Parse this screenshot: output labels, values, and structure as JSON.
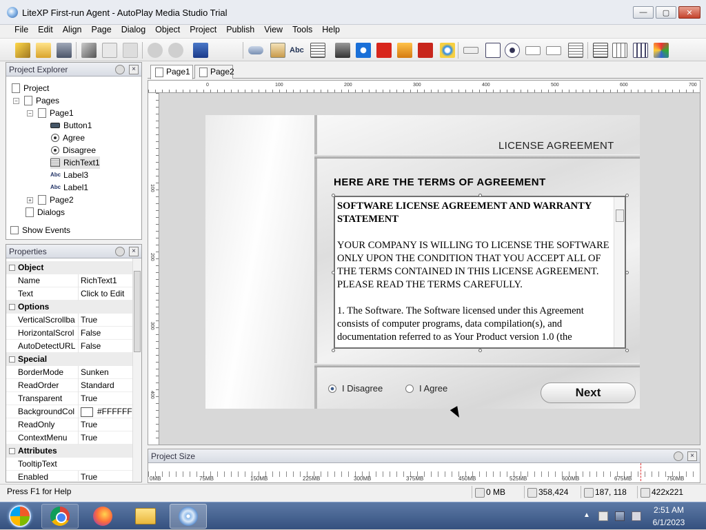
{
  "window": {
    "title": "LiteXP First-run Agent - AutoPlay Media Studio Trial",
    "min_glyph": "—",
    "max_glyph": "▢",
    "close_glyph": "✕"
  },
  "menu": [
    "File",
    "Edit",
    "Align",
    "Page",
    "Dialog",
    "Object",
    "Project",
    "Publish",
    "View",
    "Tools",
    "Help"
  ],
  "explorer": {
    "title": "Project Explorer",
    "tree": {
      "project": "Project",
      "pages": "Pages",
      "page1": "Page1",
      "button1": "Button1",
      "agree": "Agree",
      "disagree": "Disagree",
      "richtext1": "RichText1",
      "label3": "Label3",
      "label1": "Label1",
      "page2": "Page2",
      "dialogs": "Dialogs"
    },
    "show_events": "Show Events",
    "abc_glyph": "Abc"
  },
  "properties": {
    "title": "Properties",
    "cat_object": "Object",
    "name_k": "Name",
    "name_v": "RichText1",
    "text_k": "Text",
    "text_v": "Click to Edit",
    "cat_options": "Options",
    "vscroll_k": "VerticalScrollba",
    "vscroll_v": "True",
    "hscroll_k": "HorizontalScrol",
    "hscroll_v": "False",
    "autourl_k": "AutoDetectURL",
    "autourl_v": "False",
    "cat_special": "Special",
    "border_k": "BorderMode",
    "border_v": "Sunken",
    "readorder_k": "ReadOrder",
    "readorder_v": "Standard",
    "transparent_k": "Transparent",
    "transparent_v": "True",
    "bgcol_k": "BackgroundCol",
    "bgcol_v": "#FFFFFF",
    "readonly_k": "ReadOnly",
    "readonly_v": "True",
    "context_k": "ContextMenu",
    "context_v": "True",
    "cat_attributes": "Attributes",
    "tooltip_k": "TooltipText",
    "tooltip_v": "",
    "enabled_k": "Enabled",
    "enabled_v": "True"
  },
  "tabs": [
    "Page1",
    "Page2"
  ],
  "ruler": {
    "h": [
      "0",
      "100",
      "200",
      "300",
      "400",
      "500",
      "600",
      "700"
    ],
    "v": [
      "100",
      "200",
      "300",
      "400"
    ]
  },
  "page": {
    "title": "LICENSE AGREEMENT",
    "heading": "HERE ARE THE TERMS OF AGREEMENT",
    "rich_p1": "SOFTWARE LICENSE AGREEMENT AND WARRANTY STATEMENT",
    "rich_p2": "YOUR COMPANY IS WILLING TO LICENSE THE SOFTWARE ONLY UPON THE CONDITION THAT YOU ACCEPT ALL OF THE TERMS CONTAINED IN THIS LICENSE AGREEMENT. PLEASE READ THE TERMS CAREFULLY.",
    "rich_p3": "1. The Software. The Software licensed under this Agreement consists of computer programs, data compilation(s), and documentation referred to as Your Product version 1.0 (the",
    "radio_disagree": "I Disagree",
    "radio_agree": "I Agree",
    "next": "Next",
    "selected": "I Disagree"
  },
  "project_size": {
    "title": "Project Size",
    "labels": [
      "0MB",
      "75MB",
      "150MB",
      "225MB",
      "300MB",
      "375MB",
      "450MB",
      "525MB",
      "600MB",
      "675MB",
      "750MB"
    ]
  },
  "status": {
    "help": "Press F1 for Help",
    "disk": "0 MB",
    "objects": "358,424",
    "position": "187, 118",
    "size": "422x221"
  },
  "clock": {
    "time": "2:51 AM",
    "date": "6/1/2023"
  }
}
